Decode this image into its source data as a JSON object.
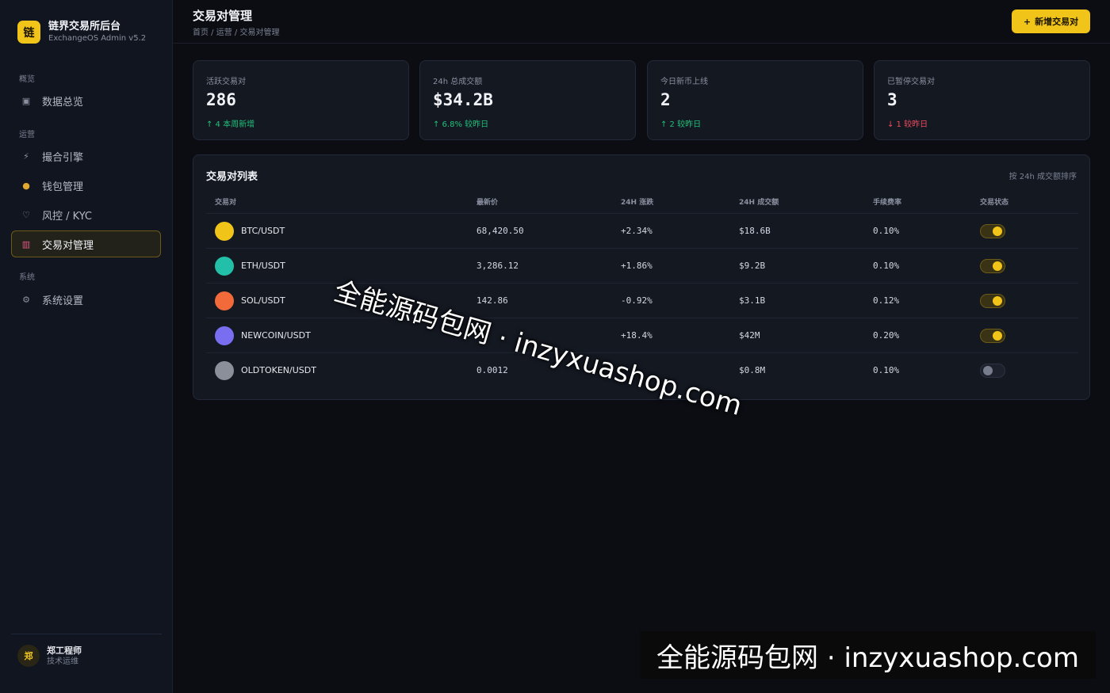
{
  "brand": {
    "logo": "链",
    "title": "链界交易所后台",
    "subtitle": "ExchangeOS Admin v5.2"
  },
  "nav": {
    "sections": [
      "概览",
      "运营",
      "系统"
    ],
    "items": [
      {
        "label": "数据总览",
        "icon": "dashboard-icon"
      },
      {
        "label": "撮合引擎",
        "icon": "lightning-icon"
      },
      {
        "label": "钱包管理",
        "icon": "money-bag-icon"
      },
      {
        "label": "风控 / KYC",
        "icon": "shield-icon"
      },
      {
        "label": "交易对管理",
        "icon": "chart-icon",
        "active": true
      },
      {
        "label": "系统设置",
        "icon": "gear-icon"
      }
    ]
  },
  "user": {
    "avatar": "郑",
    "name": "郑工程师",
    "role": "技术运维"
  },
  "header": {
    "title": "交易对管理",
    "breadcrumb": "首页 / 运营 / 交易对管理",
    "add_button": "新增交易对",
    "add_icon": "+"
  },
  "stats": [
    {
      "label": "活跃交易对",
      "value": "286",
      "delta": "↑ 4 本周新增",
      "trend": "up"
    },
    {
      "label": "24h 总成交额",
      "value": "$34.2B",
      "delta": "↑ 6.8% 较昨日",
      "trend": "up"
    },
    {
      "label": "今日新币上线",
      "value": "2",
      "delta": "↑ 2 较昨日",
      "trend": "up"
    },
    {
      "label": "已暂停交易对",
      "value": "3",
      "delta": "↓ 1 较昨日",
      "trend": "down"
    }
  ],
  "table": {
    "title": "交易对列表",
    "sort_note": "按 24h 成交额排序",
    "columns": [
      "交易对",
      "最新价",
      "24H 涨跌",
      "24H 成交额",
      "手续费率",
      "交易状态"
    ],
    "rows": [
      {
        "pair": "BTC/USDT",
        "price": "68,420.50",
        "change": "+2.34%",
        "trend": "up",
        "volume": "$18.6B",
        "fee": "0.10%",
        "enabled": true,
        "coin_color": "#f0c419"
      },
      {
        "pair": "ETH/USDT",
        "price": "3,286.12",
        "change": "+1.86%",
        "trend": "up",
        "volume": "$9.2B",
        "fee": "0.10%",
        "enabled": true,
        "coin_color": "#22c0a8"
      },
      {
        "pair": "SOL/USDT",
        "price": "142.86",
        "change": "-0.92%",
        "trend": "down",
        "volume": "$3.1B",
        "fee": "0.12%",
        "enabled": true,
        "coin_color": "#f26a3a"
      },
      {
        "pair": "NEWCOIN/USDT",
        "price": "",
        "change": "+18.4%",
        "trend": "up",
        "volume": "$42M",
        "fee": "0.20%",
        "enabled": true,
        "coin_color": "#7a6ef0"
      },
      {
        "pair": "OLDTOKEN/USDT",
        "price": "0.0012",
        "change": "",
        "trend": "down",
        "volume": "$0.8M",
        "fee": "0.10%",
        "enabled": false,
        "coin_color": "#8a8f9a"
      }
    ]
  },
  "watermark": {
    "text": "全能源码包网 · inzyxuashop.com"
  }
}
